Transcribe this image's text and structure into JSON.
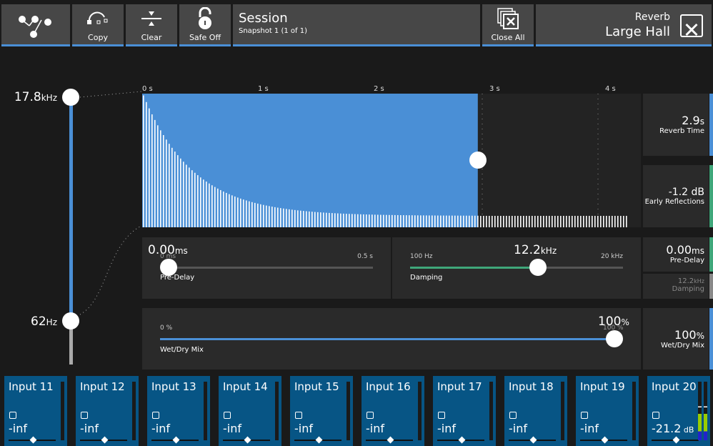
{
  "toolbar": {
    "copy": "Copy",
    "clear": "Clear",
    "safe": "Safe Off",
    "session_title": "Session",
    "session_sub": "Snapshot 1 (1 of 1)",
    "close_all": "Close All",
    "effect_type": "Reverb",
    "effect_name": "Large Hall"
  },
  "eq": {
    "high": "17.8",
    "high_unit": "kHz",
    "low": "62",
    "low_unit": "Hz"
  },
  "chart": {
    "time_labels": [
      "0 s",
      "1 s",
      "2 s",
      "3 s",
      "4 s"
    ],
    "reverb_time_s": 2.9,
    "max_s": 4.3
  },
  "predelay": {
    "value": "0.00",
    "unit": "ms",
    "min": "0 ms",
    "max": "0.5 s",
    "label": "Pre-Delay",
    "fraction": 0
  },
  "damping": {
    "value": "12.2",
    "unit": "kHz",
    "min": "100 Hz",
    "max": "20 kHz",
    "label": "Damping",
    "fraction": 0.6
  },
  "mix": {
    "value": "100",
    "unit": "%",
    "min": "0 %",
    "max": "100 %",
    "label": "Wet/Dry Mix",
    "fraction": 1
  },
  "readouts": {
    "reverb_time": "2.9",
    "reverb_time_unit": "s",
    "reverb_time_label": "Reverb Time",
    "early": "-1.2 dB",
    "early_label": "Early Reflections",
    "predelay": "0.00",
    "predelay_unit": "ms",
    "predelay_label": "Pre-Delay",
    "damping": "12.2",
    "damping_unit": "kHz",
    "damping_label": "Damping",
    "mix": "100",
    "mix_unit": "%",
    "mix_label": "Wet/Dry Mix"
  },
  "colors": {
    "accent": "#4a8fd6",
    "green": "#3fa77a",
    "channel": "#075585"
  },
  "channels": [
    {
      "name": "Input 11",
      "value": "-inf",
      "unit": ""
    },
    {
      "name": "Input 12",
      "value": "-inf",
      "unit": ""
    },
    {
      "name": "Input 13",
      "value": "-inf",
      "unit": ""
    },
    {
      "name": "Input 14",
      "value": "-inf",
      "unit": ""
    },
    {
      "name": "Input 15",
      "value": "-inf",
      "unit": ""
    },
    {
      "name": "Input 16",
      "value": "-inf",
      "unit": ""
    },
    {
      "name": "Input 17",
      "value": "-inf",
      "unit": ""
    },
    {
      "name": "Input 18",
      "value": "-inf",
      "unit": ""
    },
    {
      "name": "Input 19",
      "value": "-inf",
      "unit": ""
    },
    {
      "name": "Input 20",
      "value": "-21.2",
      "unit": "dB"
    }
  ]
}
